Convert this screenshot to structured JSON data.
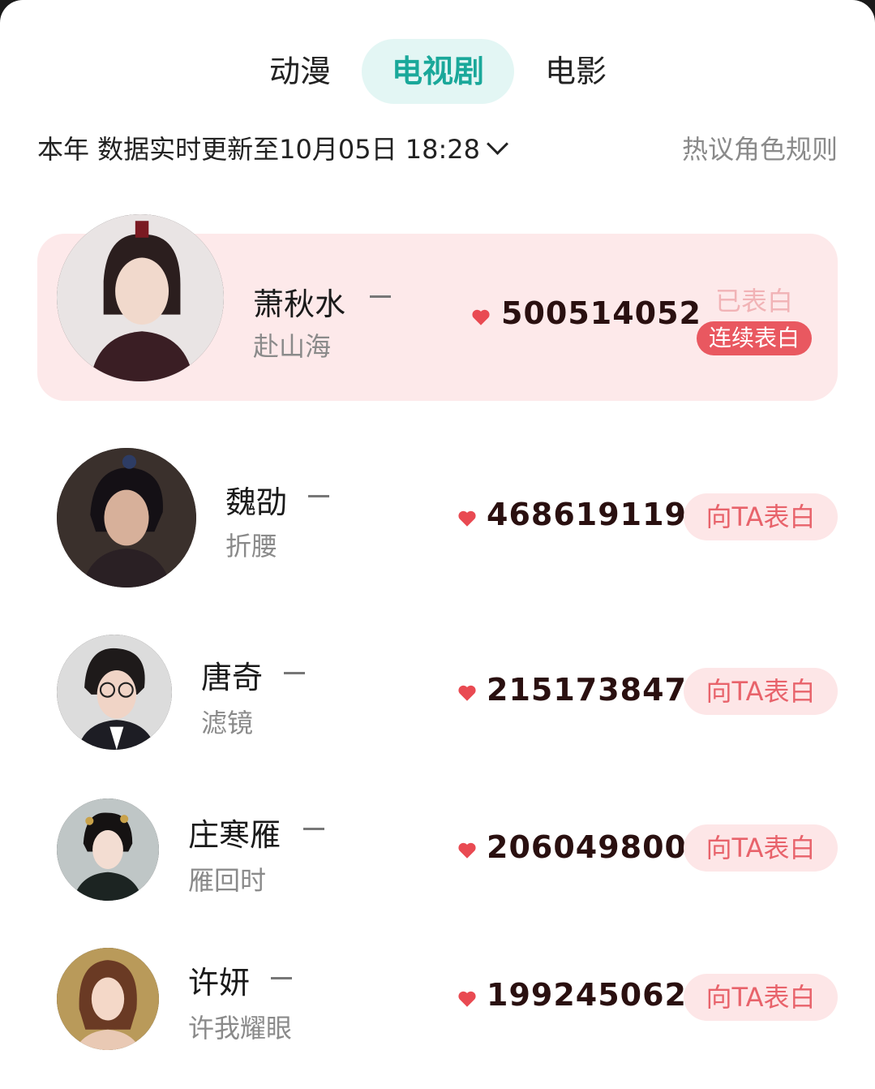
{
  "tabs": [
    {
      "label": "动漫"
    },
    {
      "label": "电视剧"
    },
    {
      "label": "电影"
    }
  ],
  "active_tab": "电视剧",
  "subheader": {
    "scope": "本年 数据实时更新至10月05日 18:28",
    "rules": "热议角色规则"
  },
  "characters": [
    {
      "name": "萧秋水",
      "show": "赴山海",
      "score": "500514052",
      "confessed_label": "已表白",
      "streak_label": "连续表白"
    },
    {
      "name": "魏劭",
      "show": "折腰",
      "score": "468619119",
      "button": "向TA表白"
    },
    {
      "name": "唐奇",
      "show": "滤镜",
      "score": "215173847",
      "button": "向TA表白"
    },
    {
      "name": "庄寒雁",
      "show": "雁回时",
      "score": "206049800",
      "button": "向TA表白"
    },
    {
      "name": "许妍",
      "show": "许我耀眼",
      "score": "199245062",
      "button": "向TA表白"
    }
  ],
  "colors": {
    "accent": "#1aa89a",
    "accent_bg": "#e3f6f4",
    "heart": "#e94a52",
    "button_text": "#e8636b",
    "highlight_row": "#fde9ea"
  }
}
